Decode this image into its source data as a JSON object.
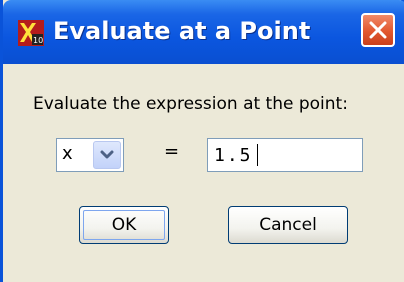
{
  "dialog": {
    "title": "Evaluate at a Point",
    "prompt": "Evaluate the expression at the point:",
    "variable_select": {
      "value": "x"
    },
    "equals_sign": "=",
    "point_value": "1.5",
    "ok_label": "OK",
    "cancel_label": "Cancel"
  },
  "icons": {
    "app": "app-logo-icon",
    "close": "close-icon",
    "dropdown": "chevron-down-icon"
  },
  "colors": {
    "titlebar": "#0b56df",
    "close_button": "#e2572e",
    "window_background": "#ece9d8"
  }
}
